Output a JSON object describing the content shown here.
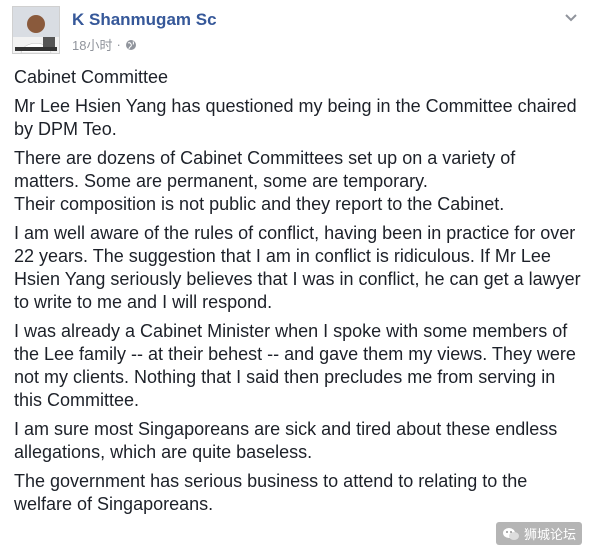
{
  "post": {
    "author": "K Shanmugam Sc",
    "timestamp": "18小时",
    "privacy_icon": "globe-icon",
    "menu_icon": "chevron-down-icon",
    "paragraphs": [
      "Cabinet Committee",
      "Mr Lee Hsien Yang has questioned my being in the Committee chaired by DPM Teo.",
      "There are dozens of Cabinet Committees set up on a variety of matters. Some are permanent, some are temporary.",
      "Their composition is not public and they report to the Cabinet.",
      "I am well aware of the rules of conflict, having been in practice for over 22 years. The suggestion that I am in conflict is ridiculous. If Mr Lee Hsien Yang seriously believes that I was in conflict, he can get a lawyer to write to me and I will respond.",
      "I was already a Cabinet Minister when I spoke with some members of the Lee family -- at their behest -- and gave them my views. They were not my clients. Nothing that I said then precludes me from serving in this Committee.",
      "I am sure most Singaporeans are sick and tired about these endless allegations, which are quite baseless.",
      "The government has serious business to attend to relating to the welfare of Singaporeans."
    ]
  },
  "watermark": {
    "text": "狮城论坛",
    "icon": "wechat-icon"
  },
  "colors": {
    "author": "#365899",
    "meta": "#90949c",
    "text": "#1d2129"
  }
}
